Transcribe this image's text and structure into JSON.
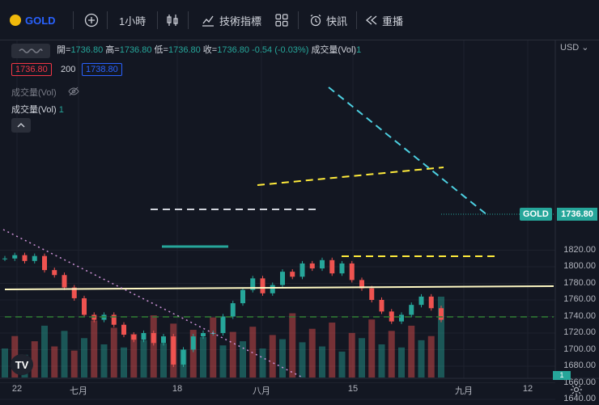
{
  "toolbar": {
    "symbol": "GOLD",
    "interval": "1小時",
    "indicators": "技術指標",
    "alert": "快訊",
    "replay": "重播"
  },
  "legend": {
    "open_label": "開=",
    "open": "1736.80",
    "high_label": "高=",
    "high": "1736.80",
    "low_label": "低=",
    "low": "1736.80",
    "close_label": "收=",
    "close": "1736.80",
    "change": "-0.54 (-0.03%)",
    "volume_label": "成交量(Vol)",
    "volume_value": "1",
    "bid": "1736.80",
    "spread": "200",
    "ask": "1738.80",
    "vol_row1": "成交量(Vol)",
    "vol_row2": "成交量(Vol)",
    "vol_row2_value": "1"
  },
  "price_axis": {
    "currency": "USD",
    "ticks": [
      "1820.00",
      "1800.00",
      "1780.00",
      "1760.00",
      "1740.00",
      "1720.00",
      "1700.00",
      "1680.00",
      "1660.00",
      "1640.00"
    ],
    "last_label": "GOLD",
    "last_price": "1736.80",
    "volume_badge": "1"
  },
  "time_axis": {
    "labels": [
      "22",
      "七月",
      "18",
      "八月",
      "15",
      "九月",
      "12"
    ]
  },
  "chart_data": {
    "type": "line",
    "title": "",
    "xlabel": "",
    "ylabel": "",
    "ylim": [
      1636,
      1836
    ],
    "x": [
      "22",
      "七月",
      "18",
      "八月",
      "15",
      "九月",
      "12"
    ],
    "series": [
      {
        "values": [
          1810,
          1814,
          1807,
          1813,
          1796,
          1790,
          1775,
          1762,
          1742,
          1736,
          1742,
          1730,
          1718,
          1712,
          1720,
          1708,
          1716,
          1682,
          1700,
          1716,
          1720,
          1720,
          1740,
          1756,
          1772,
          1786,
          1768,
          1778,
          1794,
          1788,
          1804,
          1798,
          1808,
          1792,
          1804,
          1784,
          1774,
          1760,
          1746,
          1734,
          1742,
          1754,
          1764,
          1750,
          1736
        ]
      }
    ],
    "volume": {
      "values": [
        28,
        40,
        22,
        35,
        50,
        30,
        45,
        26,
        38,
        55,
        32,
        48,
        29,
        42,
        36,
        60,
        33,
        52,
        27,
        46,
        39,
        58,
        31,
        44,
        35,
        49,
        28,
        41,
        37,
        62,
        34,
        47,
        30,
        53,
        25,
        43,
        38,
        56,
        32,
        45,
        29,
        50,
        36,
        40,
        78
      ]
    },
    "annotations": [
      {
        "label": "resistance-trendline",
        "x1": 1720,
        "y1": 1810,
        "x2": 1742,
        "y2": 1738
      },
      {
        "label": "neckline",
        "x1": 1712,
        "y1": 1756,
        "x2": 1742,
        "y2": 1764
      },
      {
        "label": "support-level",
        "x1": 1693,
        "y1": 1692,
        "x2": 1760,
        "y2": 1693
      },
      {
        "label": "descending-dotted-trendline",
        "x1": 1600,
        "y1": 1710,
        "x2": 1716,
        "y2": 1640
      }
    ]
  }
}
